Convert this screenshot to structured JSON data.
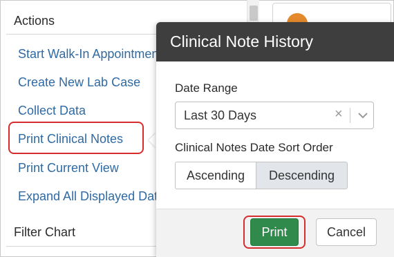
{
  "sidebar": {
    "actions_title": "Actions",
    "actions": [
      {
        "label": "Start Walk-In Appointment"
      },
      {
        "label": "Create New Lab Case"
      },
      {
        "label": "Collect Data"
      },
      {
        "label": "Print Clinical Notes"
      },
      {
        "label": "Print Current View"
      },
      {
        "label": "Expand All Displayed Data"
      }
    ],
    "filter_title": "Filter Chart"
  },
  "dialog": {
    "title": "Clinical Note History",
    "date_range_label": "Date Range",
    "date_range_value": "Last 30 Days",
    "clear_glyph": "×",
    "sort_label": "Clinical Notes Date Sort Order",
    "sort_options": [
      "Ascending",
      "Descending"
    ],
    "selected_sort": "Descending",
    "print_label": "Print",
    "cancel_label": "Cancel"
  },
  "colors": {
    "link": "#2f6aa3",
    "header_bg": "#3e3e3e",
    "print_green": "#2f8a4b",
    "highlight_red": "#d72c2c",
    "avatar_orange": "#e58a2c"
  },
  "icons": {
    "clear": "clear-icon",
    "chevron": "chevron-down-icon"
  }
}
